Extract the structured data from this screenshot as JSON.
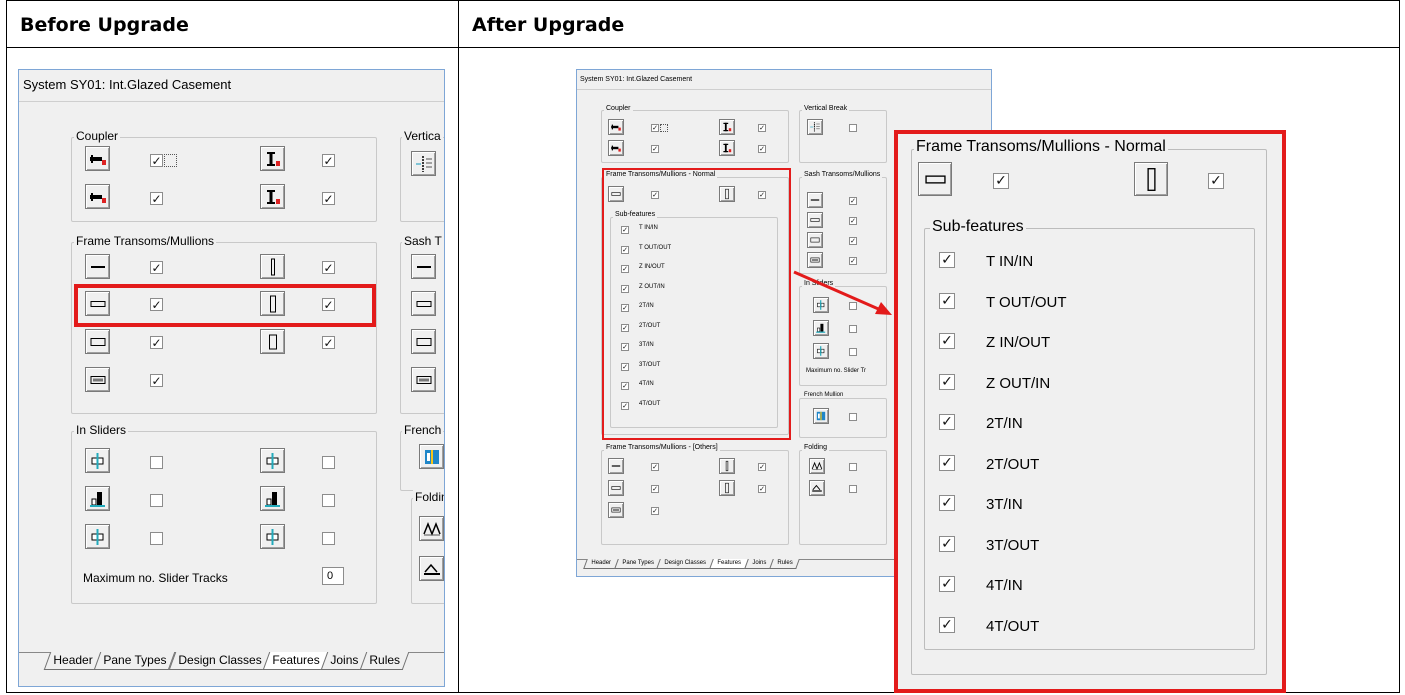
{
  "headers": {
    "before": "Before Upgrade",
    "after": "After Upgrade"
  },
  "before": {
    "window_title": "System SY01: Int.Glazed Casement",
    "coupler_label": "Coupler",
    "vertical_label": "Vertica",
    "frame_label": "Frame Transoms/Mullions",
    "sash_label": "Sash T",
    "sliders_label": "In Sliders",
    "french_label": "French",
    "folding_label": "Folding",
    "max_tracks_label": "Maximum no. Slider Tracks",
    "max_tracks_value": "0",
    "tabs": [
      "Header",
      "Pane Types",
      "Design Classes",
      "Features",
      "Joins",
      "Rules"
    ]
  },
  "after": {
    "window_title": "System SY01: Int.Glazed Casement",
    "coupler_label": "Coupler",
    "vertical_break_label": "Vertical Break",
    "frame_normal_label": "Frame Transoms/Mullions - Normal",
    "sash_label": "Sash Transoms/Mullions",
    "subfeatures_label": "Sub-features",
    "subfeatures": [
      "T IN/IN",
      "T OUT/OUT",
      "Z IN/OUT",
      "Z OUT/IN",
      "2T/IN",
      "2T/OUT",
      "3T/IN",
      "3T/OUT",
      "4T/IN",
      "4T/OUT"
    ],
    "in_sliders_label": "In Sliders",
    "max_tracks_label": "Maximum no. Slider Tr",
    "french_mullion_label": "French Mullion",
    "frame_others_label": "Frame Transoms/Mullions - [Others]",
    "folding_label": "Folding",
    "tabs": [
      "Header",
      "Pane Types",
      "Design Classes",
      "Features",
      "Joins",
      "Rules"
    ]
  },
  "zoom": {
    "frame_normal_label": "Frame Transoms/Mullions - Normal",
    "subfeatures_label": "Sub-features",
    "subfeatures": [
      "T IN/IN",
      "T OUT/OUT",
      "Z IN/OUT",
      "Z OUT/IN",
      "2T/IN",
      "2T/OUT",
      "3T/IN",
      "3T/OUT",
      "4T/IN",
      "4T/OUT"
    ]
  },
  "glyphs": {
    "check": "✓"
  },
  "colors": {
    "highlight": "#e31b1b",
    "window_border": "#7ea6d6",
    "dialog_bg": "#f0f0f0"
  }
}
